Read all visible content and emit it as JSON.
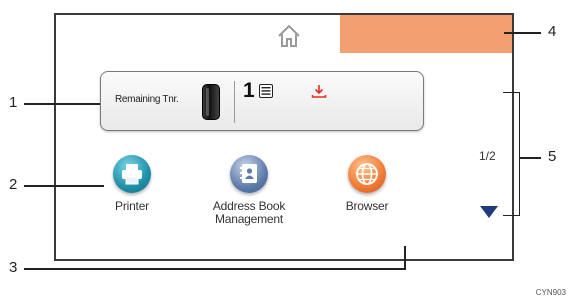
{
  "widget": {
    "toner_label": "Remaining Tnr.",
    "job_count": "1"
  },
  "icons": {
    "home": "home-icon",
    "list": "list-icon",
    "download": "download-icon",
    "down_arrow": "triangle-down-icon"
  },
  "apps": [
    {
      "label": "Printer",
      "icon": "printer-icon"
    },
    {
      "label": "Address Book\nManagement",
      "icon": "address-book-icon"
    },
    {
      "label": "Browser",
      "icon": "globe-icon"
    }
  ],
  "pager": {
    "text": "1/2"
  },
  "callouts": [
    "1",
    "2",
    "3",
    "4",
    "5"
  ],
  "figure_code": "CYN903",
  "colors": {
    "banner": "#f39f6f",
    "download": "#e0301e",
    "arrow": "#1f3c7a"
  }
}
